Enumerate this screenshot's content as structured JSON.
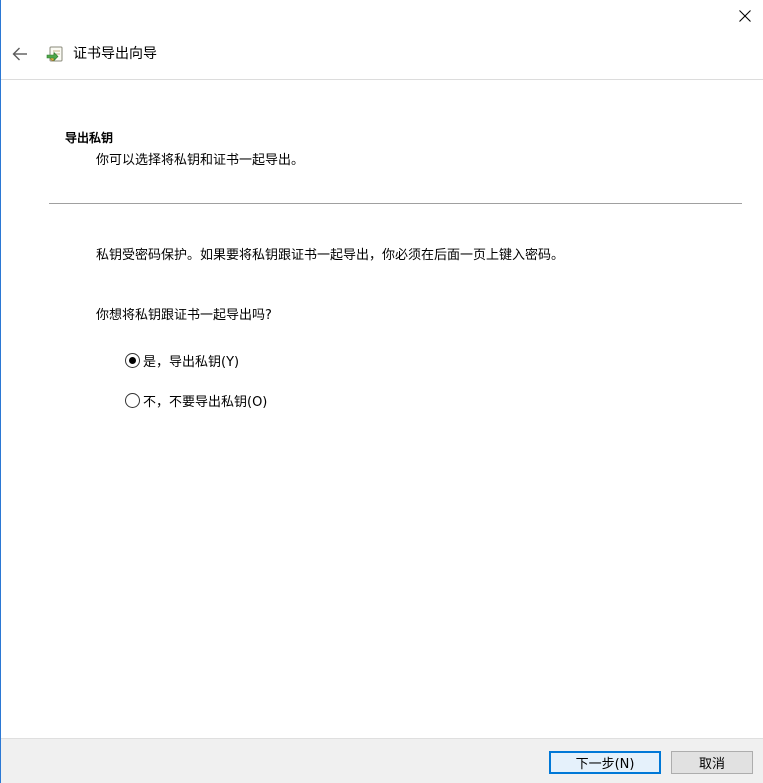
{
  "window": {
    "close_label": "×"
  },
  "header": {
    "title": "证书导出向导",
    "back_icon": "arrow-left-icon",
    "wizard_icon": "certificate-export-icon"
  },
  "section": {
    "title": "导出私钥",
    "description": "你可以选择将私钥和证书一起导出。"
  },
  "body": {
    "info": "私钥受密码保护。如果要将私钥跟证书一起导出，你必须在后面一页上键入密码。",
    "question": "你想将私钥跟证书一起导出吗?",
    "options": [
      {
        "label": "是，导出私钥(Y)",
        "checked": true
      },
      {
        "label": "不，不要导出私钥(O)",
        "checked": false
      }
    ]
  },
  "footer": {
    "next_label": "下一步(N)",
    "cancel_label": "取消"
  },
  "colors": {
    "accent": "#0078d7",
    "window_border": "#2b78d4",
    "footer_bg": "#f0f0f0"
  }
}
